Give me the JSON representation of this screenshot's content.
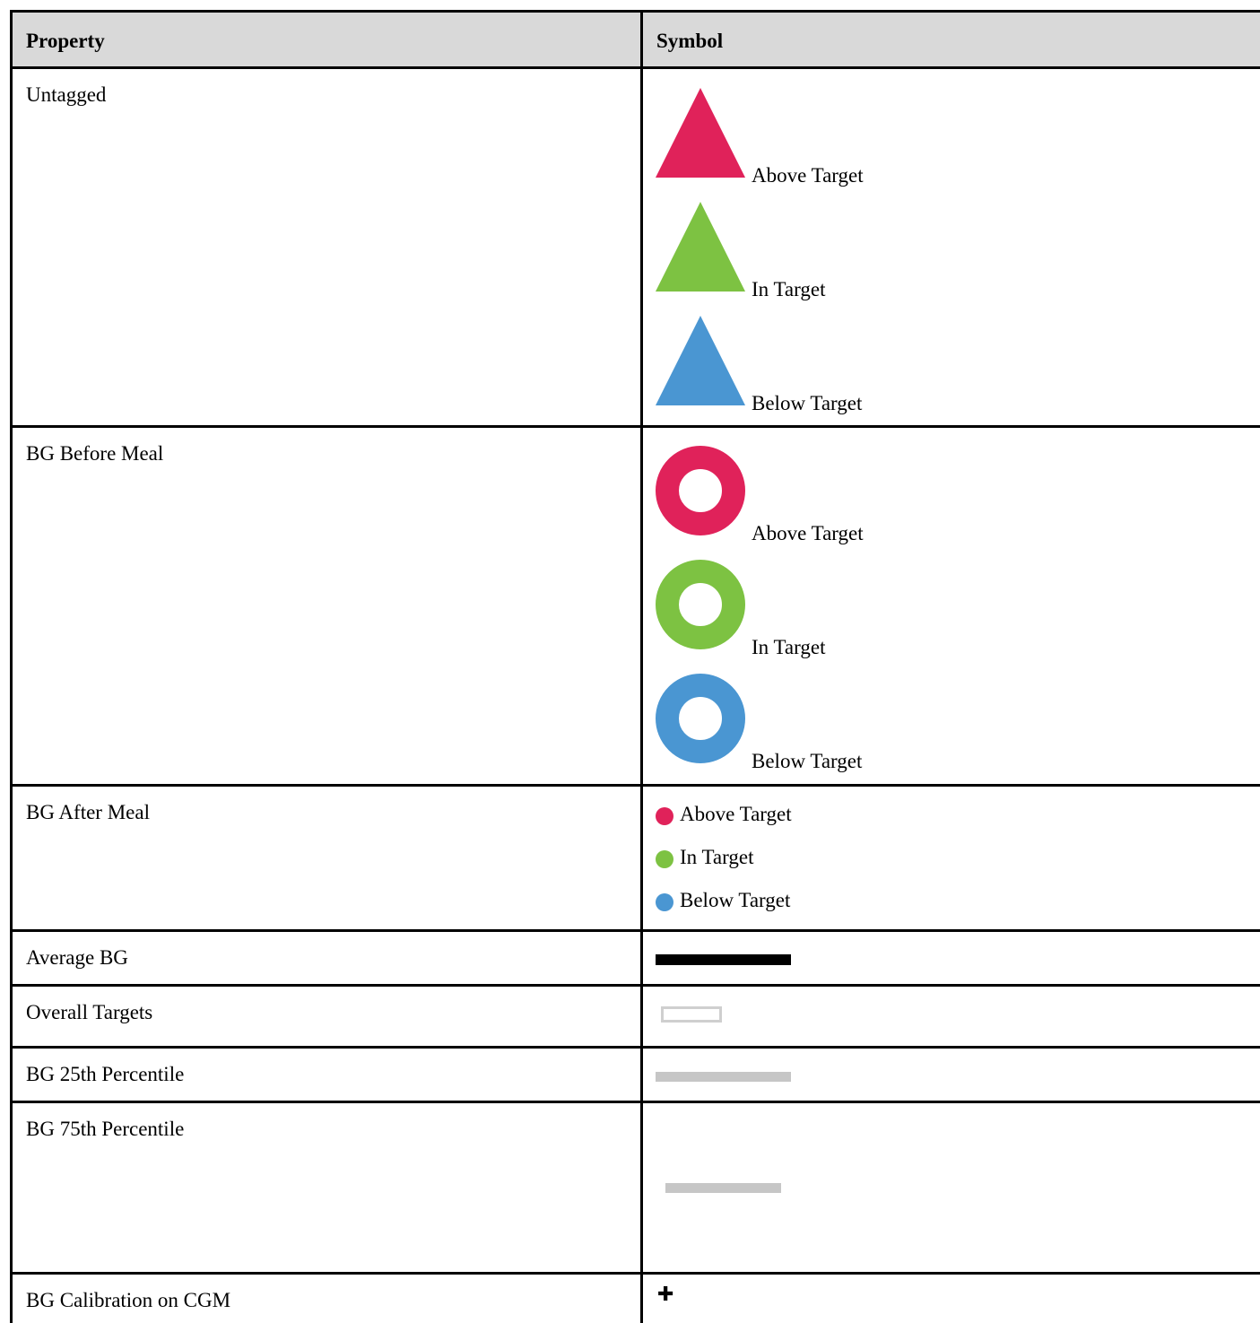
{
  "table": {
    "headers": {
      "property": "Property",
      "symbol": "Symbol"
    },
    "colors": {
      "above": "#e0225a",
      "in": "#7dc242",
      "below": "#4a96d2",
      "average": "#000000",
      "overall_outline": "#cfcfcf",
      "percentile": "#c6c6c6"
    },
    "rows": {
      "untagged": {
        "property": "Untagged",
        "symbol_shape": "triangle-icon",
        "items": [
          "Above Target",
          "In Target",
          "Below Target"
        ]
      },
      "before_meal": {
        "property": "BG Before Meal",
        "symbol_shape": "ring-icon",
        "items": [
          "Above Target",
          "In Target",
          "Below Target"
        ]
      },
      "after_meal": {
        "property": "BG After Meal",
        "symbol_shape": "dot-icon",
        "items": [
          "Above Target",
          "In Target",
          "Below Target"
        ]
      },
      "average": {
        "property": "Average BG",
        "symbol_shape": "black-bar-icon"
      },
      "overall": {
        "property": "Overall Targets",
        "symbol_shape": "outline-box-icon"
      },
      "p25": {
        "property": "BG 25th Percentile",
        "symbol_shape": "grey-bar-icon"
      },
      "p75": {
        "property": "BG 75th Percentile",
        "symbol_shape": "grey-bar-icon"
      },
      "calibration": {
        "property": "BG Calibration on CGM",
        "symbol_shape": "plus-icon",
        "symbol": "✚"
      }
    }
  }
}
